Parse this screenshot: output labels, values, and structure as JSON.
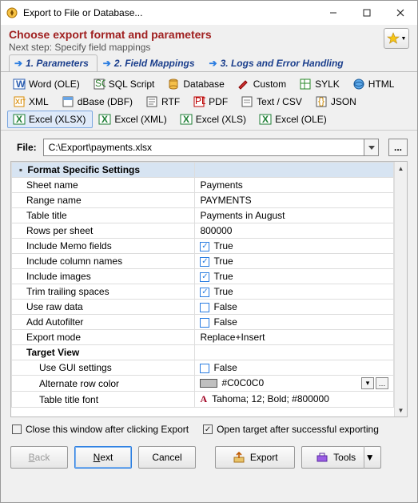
{
  "window": {
    "title": "Export to File or Database..."
  },
  "header": {
    "title": "Choose export format and parameters",
    "subtitle": "Next step: Specify field mappings"
  },
  "tabs": {
    "t1": "1. Parameters",
    "t2": "2. Field Mappings",
    "t3": "3. Logs and Error Handling"
  },
  "formats": {
    "word": "Word (OLE)",
    "sql": "SQL Script",
    "db": "Database",
    "custom": "Custom",
    "sylk": "SYLK",
    "html": "HTML",
    "xml": "XML",
    "dbase": "dBase (DBF)",
    "rtf": "RTF",
    "pdf": "PDF",
    "csv": "Text / CSV",
    "json": "JSON",
    "xlsx": "Excel (XLSX)",
    "xxml": "Excel (XML)",
    "xls": "Excel (XLS)",
    "xole": "Excel (OLE)"
  },
  "file": {
    "label": "File:",
    "value": "C:\\Export\\payments.xlsx"
  },
  "grid": {
    "section1": "Format Specific Settings",
    "sheet_name": {
      "k": "Sheet name",
      "v": "Payments"
    },
    "range_name": {
      "k": "Range name",
      "v": "PAYMENTS"
    },
    "table_title": {
      "k": "Table title",
      "v": "Payments in August"
    },
    "rows_per_sheet": {
      "k": "Rows per sheet",
      "v": "800000"
    },
    "include_memo": {
      "k": "Include Memo fields",
      "v": "True"
    },
    "include_cols": {
      "k": "Include column names",
      "v": "True"
    },
    "include_imgs": {
      "k": "Include images",
      "v": "True"
    },
    "trim": {
      "k": "Trim trailing spaces",
      "v": "True"
    },
    "raw": {
      "k": "Use raw data",
      "v": "False"
    },
    "autofilter": {
      "k": "Add Autofilter",
      "v": "False"
    },
    "export_mode": {
      "k": "Export mode",
      "v": "Replace+Insert"
    },
    "section2": "Target View",
    "use_gui": {
      "k": "Use GUI settings",
      "v": "False"
    },
    "alt_color": {
      "k": "Alternate row color",
      "v": "#C0C0C0",
      "swatch": "#c0c0c0"
    },
    "title_font": {
      "k": "Table title font",
      "v": "Tahoma; 12; Bold; #800000"
    }
  },
  "checks": {
    "close_after": {
      "label": "Close this window after clicking Export",
      "checked": false
    },
    "open_target": {
      "label": "Open target after successful exporting",
      "checked": true
    }
  },
  "buttons": {
    "back": "Back",
    "next": "Next",
    "cancel": "Cancel",
    "export": "Export",
    "tools": "Tools"
  }
}
